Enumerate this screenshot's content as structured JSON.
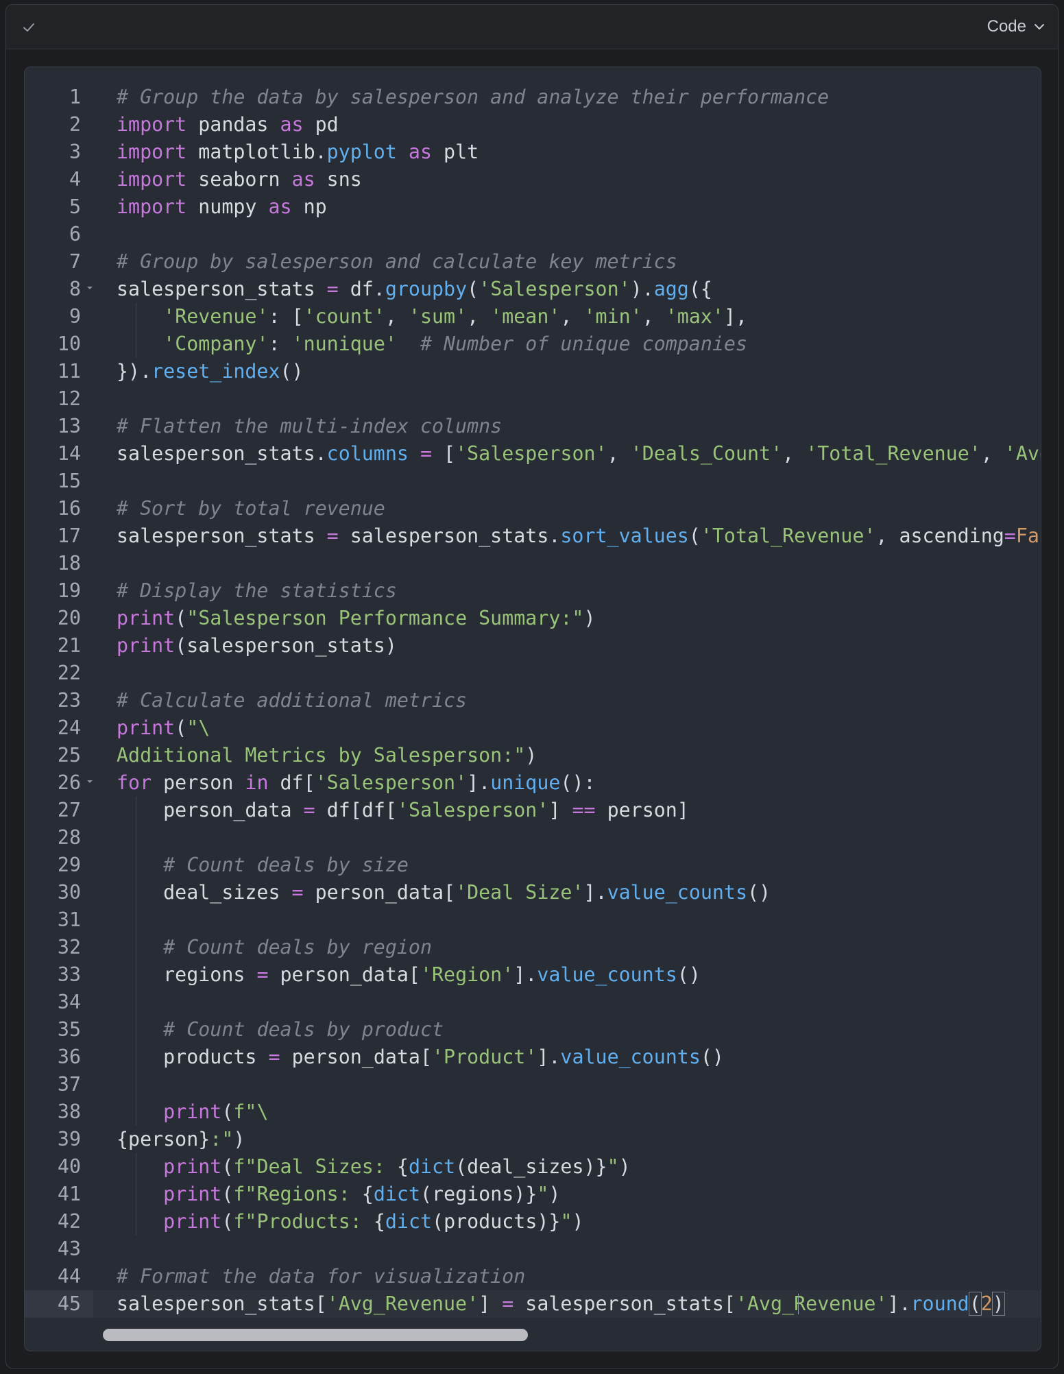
{
  "header": {
    "status_icon": "check-icon",
    "view_selector_label": "Code",
    "view_selector_icon": "chevron-down-icon"
  },
  "editor": {
    "language": "python",
    "active_line": 45,
    "colors": {
      "background": "#282c34",
      "comment": "#7f848e",
      "keyword": "#c678dd",
      "string": "#98c379",
      "function": "#61afef",
      "number": "#d19a66",
      "text": "#d7dae0",
      "line_number": "#a5a9b1"
    },
    "lines": [
      {
        "n": "1",
        "tokens": [
          {
            "t": "# Group the data by salesperson and analyze their performance",
            "c": "c"
          }
        ]
      },
      {
        "n": "2",
        "tokens": [
          {
            "t": "import",
            "c": "k"
          },
          {
            "t": " pandas "
          },
          {
            "t": "as",
            "c": "k"
          },
          {
            "t": " pd"
          }
        ]
      },
      {
        "n": "3",
        "tokens": [
          {
            "t": "import",
            "c": "k"
          },
          {
            "t": " matplotlib."
          },
          {
            "t": "pyplot",
            "c": "f"
          },
          {
            "t": " "
          },
          {
            "t": "as",
            "c": "k"
          },
          {
            "t": " plt"
          }
        ]
      },
      {
        "n": "4",
        "tokens": [
          {
            "t": "import",
            "c": "k"
          },
          {
            "t": " seaborn "
          },
          {
            "t": "as",
            "c": "k"
          },
          {
            "t": " sns"
          }
        ]
      },
      {
        "n": "5",
        "tokens": [
          {
            "t": "import",
            "c": "k"
          },
          {
            "t": " numpy "
          },
          {
            "t": "as",
            "c": "k"
          },
          {
            "t": " np"
          }
        ]
      },
      {
        "n": "6",
        "tokens": []
      },
      {
        "n": "7",
        "tokens": [
          {
            "t": "# Group by salesperson and calculate key metrics",
            "c": "c"
          }
        ]
      },
      {
        "n": "8",
        "fold": true,
        "tokens": [
          {
            "t": "salesperson_stats "
          },
          {
            "t": "=",
            "c": "k"
          },
          {
            "t": " df."
          },
          {
            "t": "groupby",
            "c": "f"
          },
          {
            "t": "("
          },
          {
            "t": "'Salesperson'",
            "c": "s"
          },
          {
            "t": ")."
          },
          {
            "t": "agg",
            "c": "f"
          },
          {
            "t": "({"
          }
        ]
      },
      {
        "n": "9",
        "guide": true,
        "tokens": [
          {
            "t": "    "
          },
          {
            "t": "'Revenue'",
            "c": "s"
          },
          {
            "t": ": ["
          },
          {
            "t": "'count'",
            "c": "s"
          },
          {
            "t": ", "
          },
          {
            "t": "'sum'",
            "c": "s"
          },
          {
            "t": ", "
          },
          {
            "t": "'mean'",
            "c": "s"
          },
          {
            "t": ", "
          },
          {
            "t": "'min'",
            "c": "s"
          },
          {
            "t": ", "
          },
          {
            "t": "'max'",
            "c": "s"
          },
          {
            "t": "],"
          }
        ]
      },
      {
        "n": "10",
        "guide": true,
        "tokens": [
          {
            "t": "    "
          },
          {
            "t": "'Company'",
            "c": "s"
          },
          {
            "t": ": "
          },
          {
            "t": "'nunique'",
            "c": "s"
          },
          {
            "t": "  "
          },
          {
            "t": "# Number of unique companies",
            "c": "c"
          }
        ]
      },
      {
        "n": "11",
        "tokens": [
          {
            "t": "})."
          },
          {
            "t": "reset_index",
            "c": "f"
          },
          {
            "t": "()"
          }
        ]
      },
      {
        "n": "12",
        "tokens": []
      },
      {
        "n": "13",
        "tokens": [
          {
            "t": "# Flatten the multi-index columns",
            "c": "c"
          }
        ]
      },
      {
        "n": "14",
        "tokens": [
          {
            "t": "salesperson_stats."
          },
          {
            "t": "columns",
            "c": "f"
          },
          {
            "t": " "
          },
          {
            "t": "=",
            "c": "k"
          },
          {
            "t": " ["
          },
          {
            "t": "'Salesperson'",
            "c": "s"
          },
          {
            "t": ", "
          },
          {
            "t": "'Deals_Count'",
            "c": "s"
          },
          {
            "t": ", "
          },
          {
            "t": "'Total_Revenue'",
            "c": "s"
          },
          {
            "t": ", "
          },
          {
            "t": "'Avg_",
            "c": "s"
          }
        ]
      },
      {
        "n": "15",
        "tokens": []
      },
      {
        "n": "16",
        "tokens": [
          {
            "t": "# Sort by total revenue",
            "c": "c"
          }
        ]
      },
      {
        "n": "17",
        "tokens": [
          {
            "t": "salesperson_stats "
          },
          {
            "t": "=",
            "c": "k"
          },
          {
            "t": " salesperson_stats."
          },
          {
            "t": "sort_values",
            "c": "f"
          },
          {
            "t": "("
          },
          {
            "t": "'Total_Revenue'",
            "c": "s"
          },
          {
            "t": ", ascending"
          },
          {
            "t": "=",
            "c": "k"
          },
          {
            "t": "False",
            "c": "n"
          }
        ]
      },
      {
        "n": "18",
        "tokens": []
      },
      {
        "n": "19",
        "tokens": [
          {
            "t": "# Display the statistics",
            "c": "c"
          }
        ]
      },
      {
        "n": "20",
        "tokens": [
          {
            "t": "print",
            "c": "k"
          },
          {
            "t": "("
          },
          {
            "t": "\"Salesperson Performance Summary:\"",
            "c": "s"
          },
          {
            "t": ")"
          }
        ]
      },
      {
        "n": "21",
        "tokens": [
          {
            "t": "print",
            "c": "k"
          },
          {
            "t": "(salesperson_stats)"
          }
        ]
      },
      {
        "n": "22",
        "tokens": []
      },
      {
        "n": "23",
        "tokens": [
          {
            "t": "# Calculate additional metrics",
            "c": "c"
          }
        ]
      },
      {
        "n": "24",
        "tokens": [
          {
            "t": "print",
            "c": "k"
          },
          {
            "t": "("
          },
          {
            "t": "\"\\",
            "c": "s"
          }
        ]
      },
      {
        "n": "25",
        "tokens": [
          {
            "t": "Additional Metrics by Salesperson:\"",
            "c": "s"
          },
          {
            "t": ")"
          }
        ]
      },
      {
        "n": "26",
        "fold": true,
        "tokens": [
          {
            "t": "for",
            "c": "k"
          },
          {
            "t": " person "
          },
          {
            "t": "in",
            "c": "k"
          },
          {
            "t": " df["
          },
          {
            "t": "'Salesperson'",
            "c": "s"
          },
          {
            "t": "]."
          },
          {
            "t": "unique",
            "c": "f"
          },
          {
            "t": "():"
          }
        ]
      },
      {
        "n": "27",
        "guide": true,
        "tokens": [
          {
            "t": "    person_data "
          },
          {
            "t": "=",
            "c": "k"
          },
          {
            "t": " df[df["
          },
          {
            "t": "'Salesperson'",
            "c": "s"
          },
          {
            "t": "] "
          },
          {
            "t": "==",
            "c": "k"
          },
          {
            "t": " person]"
          }
        ]
      },
      {
        "n": "28",
        "guide": true,
        "tokens": []
      },
      {
        "n": "29",
        "guide": true,
        "tokens": [
          {
            "t": "    "
          },
          {
            "t": "# Count deals by size",
            "c": "c"
          }
        ]
      },
      {
        "n": "30",
        "guide": true,
        "tokens": [
          {
            "t": "    deal_sizes "
          },
          {
            "t": "=",
            "c": "k"
          },
          {
            "t": " person_data["
          },
          {
            "t": "'Deal Size'",
            "c": "s"
          },
          {
            "t": "]."
          },
          {
            "t": "value_counts",
            "c": "f"
          },
          {
            "t": "()"
          }
        ]
      },
      {
        "n": "31",
        "guide": true,
        "tokens": []
      },
      {
        "n": "32",
        "guide": true,
        "tokens": [
          {
            "t": "    "
          },
          {
            "t": "# Count deals by region",
            "c": "c"
          }
        ]
      },
      {
        "n": "33",
        "guide": true,
        "tokens": [
          {
            "t": "    regions "
          },
          {
            "t": "=",
            "c": "k"
          },
          {
            "t": " person_data["
          },
          {
            "t": "'Region'",
            "c": "s"
          },
          {
            "t": "]."
          },
          {
            "t": "value_counts",
            "c": "f"
          },
          {
            "t": "()"
          }
        ]
      },
      {
        "n": "34",
        "guide": true,
        "tokens": []
      },
      {
        "n": "35",
        "guide": true,
        "tokens": [
          {
            "t": "    "
          },
          {
            "t": "# Count deals by product",
            "c": "c"
          }
        ]
      },
      {
        "n": "36",
        "guide": true,
        "tokens": [
          {
            "t": "    products "
          },
          {
            "t": "=",
            "c": "k"
          },
          {
            "t": " person_data["
          },
          {
            "t": "'Product'",
            "c": "s"
          },
          {
            "t": "]."
          },
          {
            "t": "value_counts",
            "c": "f"
          },
          {
            "t": "()"
          }
        ]
      },
      {
        "n": "37",
        "guide": true,
        "tokens": []
      },
      {
        "n": "38",
        "guide": true,
        "tokens": [
          {
            "t": "    "
          },
          {
            "t": "print",
            "c": "k"
          },
          {
            "t": "("
          },
          {
            "t": "f\"\\",
            "c": "s"
          }
        ]
      },
      {
        "n": "39",
        "tokens": [
          {
            "t": "{person}"
          },
          {
            "t": ":\"",
            "c": "s"
          },
          {
            "t": ")"
          }
        ]
      },
      {
        "n": "40",
        "guide": true,
        "tokens": [
          {
            "t": "    "
          },
          {
            "t": "print",
            "c": "k"
          },
          {
            "t": "("
          },
          {
            "t": "f\"Deal Sizes: ",
            "c": "s"
          },
          {
            "t": "{"
          },
          {
            "t": "dict",
            "c": "f"
          },
          {
            "t": "(deal_sizes)}"
          },
          {
            "t": "\"",
            "c": "s"
          },
          {
            "t": ")"
          }
        ]
      },
      {
        "n": "41",
        "guide": true,
        "tokens": [
          {
            "t": "    "
          },
          {
            "t": "print",
            "c": "k"
          },
          {
            "t": "("
          },
          {
            "t": "f\"Regions: ",
            "c": "s"
          },
          {
            "t": "{"
          },
          {
            "t": "dict",
            "c": "f"
          },
          {
            "t": "(regions)}"
          },
          {
            "t": "\"",
            "c": "s"
          },
          {
            "t": ")"
          }
        ]
      },
      {
        "n": "42",
        "guide": true,
        "tokens": [
          {
            "t": "    "
          },
          {
            "t": "print",
            "c": "k"
          },
          {
            "t": "("
          },
          {
            "t": "f\"Products: ",
            "c": "s"
          },
          {
            "t": "{"
          },
          {
            "t": "dict",
            "c": "f"
          },
          {
            "t": "(products)}"
          },
          {
            "t": "\"",
            "c": "s"
          },
          {
            "t": ")"
          }
        ]
      },
      {
        "n": "43",
        "tokens": []
      },
      {
        "n": "44",
        "tokens": [
          {
            "t": "# Format the data for visualization",
            "c": "c"
          }
        ]
      },
      {
        "n": "45",
        "tokens": [
          {
            "t": "salesperson_stats["
          },
          {
            "t": "'Avg_Revenue'",
            "c": "s"
          },
          {
            "t": "] "
          },
          {
            "t": "=",
            "c": "k"
          },
          {
            "t": " salesperson_stats["
          },
          {
            "t": "'Avg_Revenue'",
            "c": "s"
          },
          {
            "t": "]."
          },
          {
            "t": "round",
            "c": "f"
          },
          {
            "t": "(",
            "c": "bm"
          },
          {
            "t": "2",
            "c": "n"
          },
          {
            "t": ")",
            "c": "bm"
          }
        ]
      }
    ]
  },
  "scrollbar": {
    "horizontal_position": 0.0,
    "visible_fraction": 0.53
  }
}
